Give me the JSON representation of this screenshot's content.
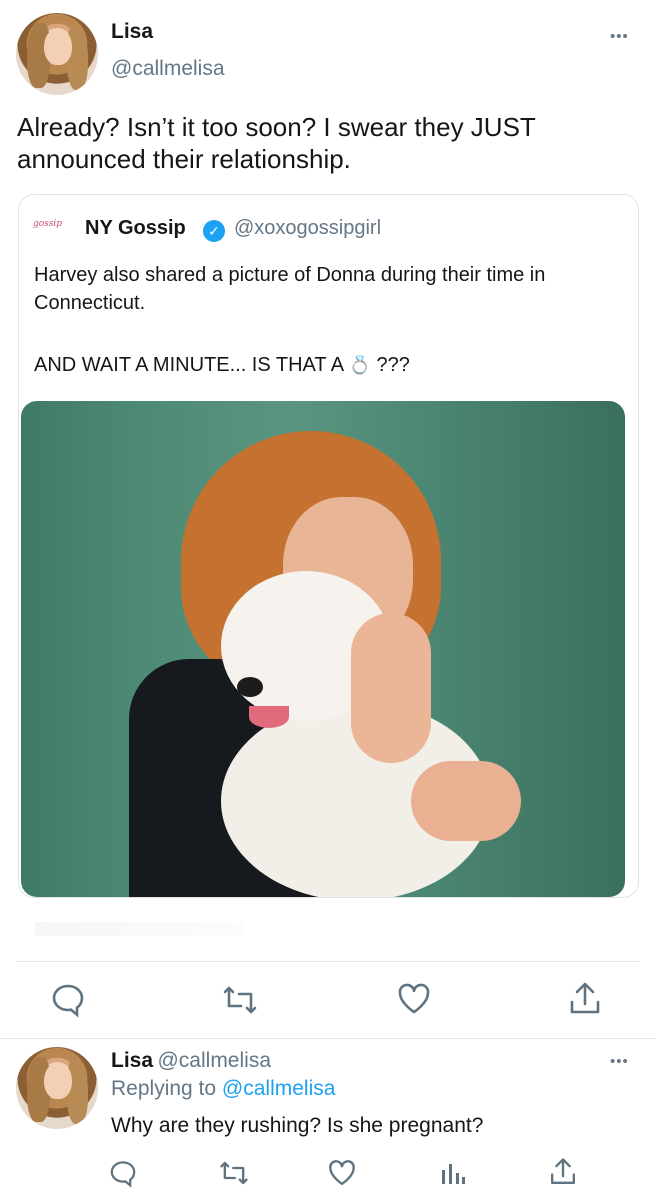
{
  "tweet": {
    "author_name": "Lisa",
    "author_handle": "@callmelisa",
    "more": "•••",
    "text": "Already? Isn’t it too soon? I swear they JUST announced their relationship."
  },
  "quote": {
    "logo_text": "gossip",
    "author_name": "NY Gossip",
    "verified_mark": "✓",
    "author_handle": "@xoxogossipgirl",
    "text_line1": "Harvey also shared a picture of Donna during their time in Connecticut.",
    "text_line2_prefix": "AND WAIT A MINUTE... IS THAT A",
    "ring_emoji": "💍",
    "text_line2_suffix": "???"
  },
  "actions": {
    "reply_icon": "reply-icon",
    "retweet_icon": "retweet-icon",
    "like_icon": "like-icon",
    "share_icon": "share-icon"
  },
  "reply": {
    "author_name": "Lisa",
    "author_handle": "@callmelisa",
    "more": "•••",
    "replying_to_prefix": "Replying to",
    "replying_to_handle": "@callmelisa",
    "text": "Why are they rushing? Is she pregnant?"
  },
  "colors": {
    "accent": "#1da1f2",
    "muted": "#657786",
    "text": "#14171a",
    "border": "#e1e8ed"
  }
}
